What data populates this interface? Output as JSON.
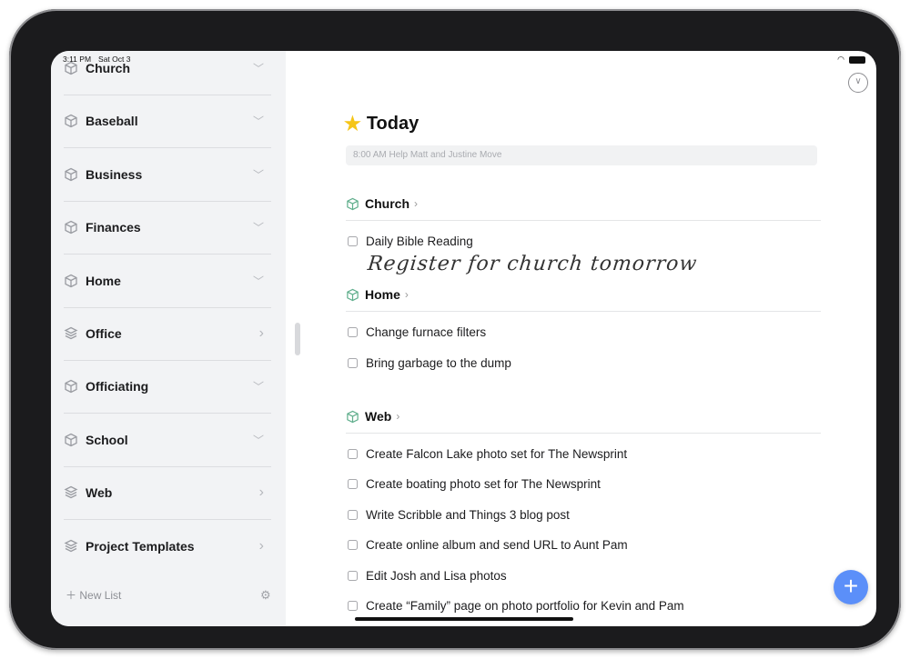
{
  "status_bar": {
    "time": "3:11 PM",
    "date": "Sat Oct 3",
    "wifi_icon": "wifi-icon",
    "battery_icon": "battery-icon"
  },
  "sidebar": {
    "items": [
      {
        "label": "Church",
        "chevron": "down",
        "icon": "box"
      },
      {
        "label": "Baseball",
        "chevron": "down",
        "icon": "box"
      },
      {
        "label": "Business",
        "chevron": "down",
        "icon": "box"
      },
      {
        "label": "Finances",
        "chevron": "down",
        "icon": "box"
      },
      {
        "label": "Home",
        "chevron": "down",
        "icon": "box"
      },
      {
        "label": "Office",
        "chevron": "right",
        "icon": "stack"
      },
      {
        "label": "Officiating",
        "chevron": "down",
        "icon": "box"
      },
      {
        "label": "School",
        "chevron": "down",
        "icon": "box"
      },
      {
        "label": "Web",
        "chevron": "right",
        "icon": "stack"
      },
      {
        "label": "Project Templates",
        "chevron": "right",
        "icon": "stack"
      }
    ],
    "new_list": "New List"
  },
  "main": {
    "title": "Today",
    "event": "8:00 AM Help Matt and Justine Move",
    "sections": [
      {
        "name": "Church",
        "tasks": [
          "Daily Bible Reading"
        ],
        "handwriting": "Register for church tomorrow"
      },
      {
        "name": "Home",
        "tasks": [
          "Change furnace filters",
          "Bring garbage to the dump"
        ]
      },
      {
        "name": "Web",
        "tasks": [
          "Create Falcon Lake photo set for The Newsprint",
          "Create boating photo set for The Newsprint",
          "Write Scribble and Things 3 blog post",
          "Create online album and send URL to Aunt Pam",
          "Edit Josh and Lisa photos",
          "Create “Family” page on photo portfolio for Kevin and Pam"
        ]
      }
    ]
  },
  "colors": {
    "accent": "#5b8ff9",
    "section_icon": "#5fae8c",
    "star": "#f5c518",
    "sidebar_bg": "#f2f3f5"
  }
}
